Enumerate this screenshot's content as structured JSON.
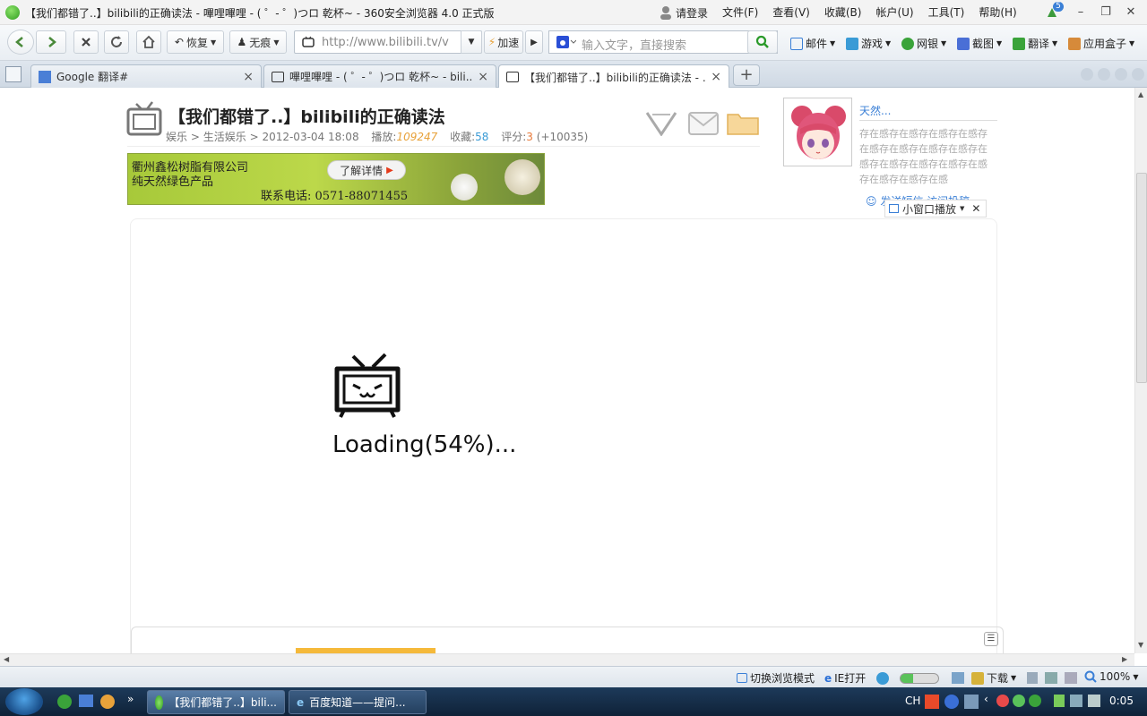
{
  "window": {
    "title": "【我们都错了..】bilibili的正确读法 - 嗶哩嗶哩 - ( ゜- ゜)つロ 乾杯~ - 360安全浏览器 4.0 正式版",
    "login": "请登录",
    "menus": [
      "文件(F)",
      "查看(V)",
      "收藏(B)",
      "帐户(U)",
      "工具(T)",
      "帮助(H)"
    ],
    "badge": "5"
  },
  "toolbar": {
    "restore_label": "恢复",
    "incognito_label": "无痕",
    "url": "http://www.bilibili.tv/v",
    "accelerate_label": "加速",
    "search_placeholder": "输入文字，直接搜索",
    "links": [
      "邮件",
      "游戏",
      "网银",
      "截图",
      "翻译",
      "应用盒子"
    ]
  },
  "tabs": [
    {
      "label": "Google 翻译#",
      "active": false
    },
    {
      "label": "嗶哩嗶哩 - ( ゜- ゜)つロ 乾杯~ - bili...",
      "active": false
    },
    {
      "label": "【我们都错了..】bilibili的正确读法 - ...",
      "active": true
    }
  ],
  "video": {
    "title": "【我们都错了..】bilibili的正确读法",
    "category": "娱乐",
    "subcategory": "生活娱乐",
    "date": "2012-03-04 18:08",
    "plays_label": "播放:",
    "plays": "109247",
    "favs_label": "收藏:",
    "favs": "58",
    "score_label": "评分:",
    "score": "3",
    "score_delta": "(+10035)"
  },
  "ad": {
    "company": "衢州鑫松树脂有限公司",
    "slogan": "纯天然绿色产品",
    "phone": "联系电话: 0571-88071455",
    "button": "了解详情"
  },
  "uploader": {
    "name": "天然...",
    "description": "存在感存在感存在感存在感存在感存在感存在感存在感存在感存在感存在感存在感存在感存在感存在感存在感"
  },
  "miniplayer": {
    "under_label": "发送短信  访问投稿",
    "label": "小窗口播放"
  },
  "player": {
    "loading_text": "Loading(54%)..."
  },
  "statusbar": {
    "switch_mode": "切换浏览模式",
    "ie_open": "IE打开",
    "download": "下载",
    "zoom": "100%"
  },
  "taskbar": {
    "tasks": [
      "【我们都错了..】bili...",
      "百度知道——提问..."
    ],
    "lang": "CH",
    "time": "0:05"
  },
  "colors": {
    "link_blue": "#3a7fd6",
    "plays_orange": "#e8a23a",
    "favs_blue": "#3a9bd6",
    "search_green": "#2a9a2a"
  }
}
